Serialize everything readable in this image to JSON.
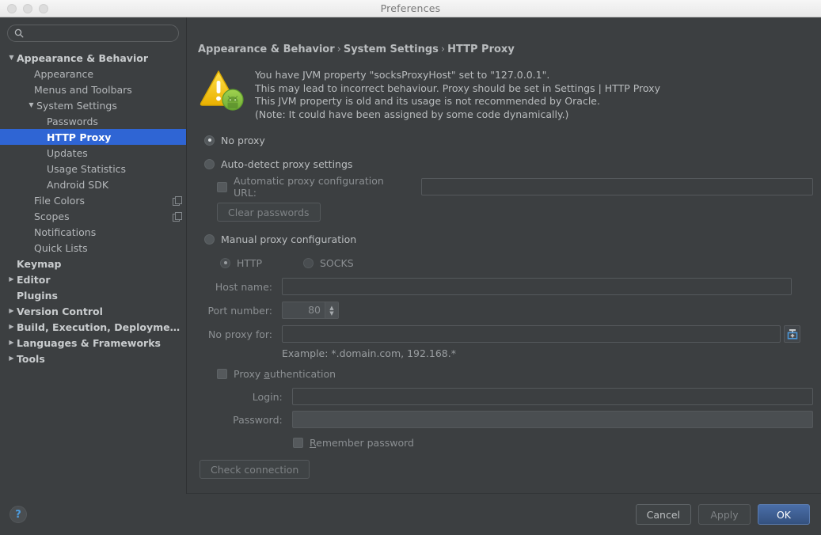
{
  "window": {
    "title": "Preferences",
    "traffic_lights": [
      "close-button",
      "minimize-button",
      "zoom-button"
    ]
  },
  "sidebar": {
    "search": {
      "value": "",
      "placeholder": ""
    },
    "items": [
      {
        "label": "Appearance & Behavior",
        "indent": 0,
        "arrow": "▼",
        "bold": true,
        "selected": false,
        "copy_icon": false
      },
      {
        "label": "Appearance",
        "indent": 1,
        "arrow": "",
        "bold": false,
        "selected": false,
        "copy_icon": false
      },
      {
        "label": "Menus and Toolbars",
        "indent": 1,
        "arrow": "",
        "bold": false,
        "selected": false,
        "copy_icon": false
      },
      {
        "label": "System Settings",
        "indent": 2,
        "arrow": "▼",
        "bold": false,
        "selected": false,
        "copy_icon": false
      },
      {
        "label": "Passwords",
        "indent": 3,
        "arrow": "",
        "bold": false,
        "selected": false,
        "copy_icon": false
      },
      {
        "label": "HTTP Proxy",
        "indent": 3,
        "arrow": "",
        "bold": false,
        "selected": true,
        "copy_icon": false
      },
      {
        "label": "Updates",
        "indent": 3,
        "arrow": "",
        "bold": false,
        "selected": false,
        "copy_icon": false
      },
      {
        "label": "Usage Statistics",
        "indent": 3,
        "arrow": "",
        "bold": false,
        "selected": false,
        "copy_icon": false
      },
      {
        "label": "Android SDK",
        "indent": 3,
        "arrow": "",
        "bold": false,
        "selected": false,
        "copy_icon": false
      },
      {
        "label": "File Colors",
        "indent": 1,
        "arrow": "",
        "bold": false,
        "selected": false,
        "copy_icon": true
      },
      {
        "label": "Scopes",
        "indent": 1,
        "arrow": "",
        "bold": false,
        "selected": false,
        "copy_icon": true
      },
      {
        "label": "Notifications",
        "indent": 1,
        "arrow": "",
        "bold": false,
        "selected": false,
        "copy_icon": false
      },
      {
        "label": "Quick Lists",
        "indent": 1,
        "arrow": "",
        "bold": false,
        "selected": false,
        "copy_icon": false
      },
      {
        "label": "Keymap",
        "indent": 0,
        "arrow": "",
        "bold": true,
        "selected": false,
        "copy_icon": false
      },
      {
        "label": "Editor",
        "indent": 0,
        "arrow": "▶",
        "bold": true,
        "selected": false,
        "copy_icon": false
      },
      {
        "label": "Plugins",
        "indent": 0,
        "arrow": "",
        "bold": true,
        "selected": false,
        "copy_icon": false
      },
      {
        "label": "Version Control",
        "indent": 0,
        "arrow": "▶",
        "bold": true,
        "selected": false,
        "copy_icon": false
      },
      {
        "label": "Build, Execution, Deployment",
        "indent": 0,
        "arrow": "▶",
        "bold": true,
        "selected": false,
        "copy_icon": false
      },
      {
        "label": "Languages & Frameworks",
        "indent": 0,
        "arrow": "▶",
        "bold": true,
        "selected": false,
        "copy_icon": false
      },
      {
        "label": "Tools",
        "indent": 0,
        "arrow": "▶",
        "bold": true,
        "selected": false,
        "copy_icon": false
      }
    ]
  },
  "breadcrumb": {
    "part1": "Appearance & Behavior",
    "sep1": "›",
    "part2": "System Settings",
    "sep2": "›",
    "part3": "HTTP Proxy"
  },
  "warning": {
    "icon": "warning-triangle-android-icon",
    "line1": "You have JVM property \"socksProxyHost\" set to \"127.0.0.1\".",
    "line2": "This may lead to incorrect behaviour. Proxy should be set in Settings | HTTP Proxy",
    "line3": "This JVM property is old and its usage is not recommended by Oracle.",
    "line4": "(Note: It could have been assigned by some code dynamically.)"
  },
  "form": {
    "no_proxy_label": "No proxy",
    "no_proxy_selected": true,
    "auto_detect_label": "Auto-detect proxy settings",
    "auto_detect_selected": false,
    "auto_config_url_label": "Automatic proxy configuration URL:",
    "auto_config_url_value": "",
    "auto_config_url_checked": false,
    "clear_passwords_label": "Clear passwords",
    "manual_label": "Manual proxy configuration",
    "manual_selected": false,
    "http_label": "HTTP",
    "http_selected": true,
    "socks_label": "SOCKS",
    "socks_selected": false,
    "host_name_label": "Host name:",
    "host_name_value": "",
    "port_number_label": "Port number:",
    "port_number_value": "80",
    "no_proxy_for_label": "No proxy for:",
    "no_proxy_for_value": "",
    "expand_icon": "expand-editor-icon",
    "example_hint": "Example: *.domain.com, 192.168.*",
    "proxy_auth_label": "Proxy authentication",
    "proxy_auth_mnemonic": "a",
    "proxy_auth_checked": false,
    "login_label": "Login:",
    "login_value": "",
    "password_label": "Password:",
    "password_value": "",
    "remember_password_label": "Remember password",
    "remember_password_mnemonic": "R",
    "remember_password_checked": false,
    "check_connection_label": "Check connection"
  },
  "bottom": {
    "help_icon": "question-mark-icon",
    "help_label": "?",
    "cancel_label": "Cancel",
    "apply_label": "Apply",
    "ok_label": "OK"
  },
  "colors": {
    "window_bg": "#3c3f41",
    "selection_blue": "#2f65d4",
    "primary_button": "#3e5f94",
    "warning_yellow": "#f2c21c",
    "android_green": "#7fbb42",
    "help_blue": "#4d9de0"
  }
}
